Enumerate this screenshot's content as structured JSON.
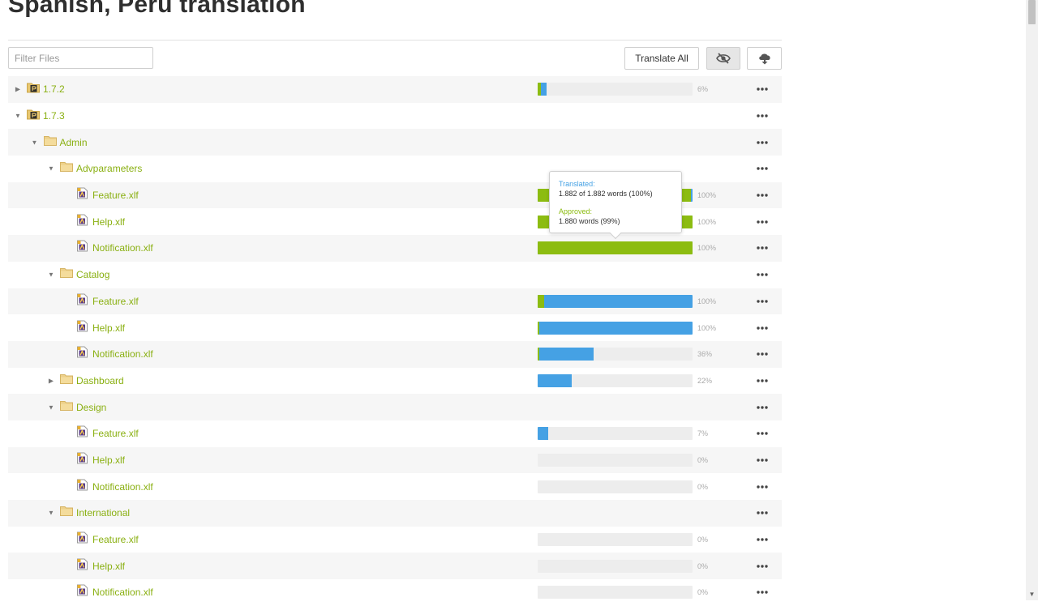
{
  "page_title": "Spanish, Peru translation",
  "filter": {
    "placeholder": "Filter Files",
    "value": ""
  },
  "toolbar": {
    "translate_all_label": "Translate All",
    "hide_icon": "eye-off-icon",
    "download_icon": "cloud-download-icon"
  },
  "colors": {
    "translated": "#45a1e4",
    "approved": "#8cbc11",
    "label": "#8ab012"
  },
  "tree": [
    {
      "type": "version",
      "label": "1.7.2",
      "level": 0,
      "toggle": "collapsed",
      "translated": 0.06,
      "approved": 0.02,
      "pct": "6%"
    },
    {
      "type": "version",
      "label": "1.7.3",
      "level": 0,
      "toggle": "expanded"
    },
    {
      "type": "folder",
      "label": "Admin",
      "level": 1,
      "toggle": "expanded"
    },
    {
      "type": "folder",
      "label": "Advparameters",
      "level": 2,
      "toggle": "expanded"
    },
    {
      "type": "file",
      "label": "Feature.xlf",
      "level": 3,
      "translated": 1.0,
      "approved": 0.99,
      "pct": "100%"
    },
    {
      "type": "file",
      "label": "Help.xlf",
      "level": 3,
      "translated": 1.0,
      "approved": 1.0,
      "pct": "100%"
    },
    {
      "type": "file",
      "label": "Notification.xlf",
      "level": 3,
      "translated": 1.0,
      "approved": 1.0,
      "pct": "100%"
    },
    {
      "type": "folder",
      "label": "Catalog",
      "level": 2,
      "toggle": "expanded"
    },
    {
      "type": "file",
      "label": "Feature.xlf",
      "level": 3,
      "translated": 1.0,
      "approved": 0.04,
      "pct": "100%"
    },
    {
      "type": "file",
      "label": "Help.xlf",
      "level": 3,
      "translated": 1.0,
      "approved": 0.01,
      "pct": "100%"
    },
    {
      "type": "file",
      "label": "Notification.xlf",
      "level": 3,
      "translated": 0.36,
      "approved": 0.01,
      "pct": "36%"
    },
    {
      "type": "folder",
      "label": "Dashboard",
      "level": 2,
      "toggle": "collapsed",
      "translated": 0.22,
      "approved": 0,
      "pct": "22%"
    },
    {
      "type": "folder",
      "label": "Design",
      "level": 2,
      "toggle": "expanded"
    },
    {
      "type": "file",
      "label": "Feature.xlf",
      "level": 3,
      "translated": 0.07,
      "approved": 0,
      "pct": "7%"
    },
    {
      "type": "file",
      "label": "Help.xlf",
      "level": 3,
      "translated": 0,
      "approved": 0,
      "pct": "0%"
    },
    {
      "type": "file",
      "label": "Notification.xlf",
      "level": 3,
      "translated": 0,
      "approved": 0,
      "pct": "0%"
    },
    {
      "type": "folder",
      "label": "International",
      "level": 2,
      "toggle": "expanded"
    },
    {
      "type": "file",
      "label": "Feature.xlf",
      "level": 3,
      "translated": 0,
      "approved": 0,
      "pct": "0%"
    },
    {
      "type": "file",
      "label": "Help.xlf",
      "level": 3,
      "translated": 0,
      "approved": 0,
      "pct": "0%"
    },
    {
      "type": "file",
      "label": "Notification.xlf",
      "level": 3,
      "translated": 0,
      "approved": 0,
      "pct": "0%"
    }
  ],
  "tooltip": {
    "translated_label": "Translated:",
    "translated_value": "1.882 of 1.882 words (100%)",
    "approved_label": "Approved:",
    "approved_value": "1.880 words (99%)"
  }
}
